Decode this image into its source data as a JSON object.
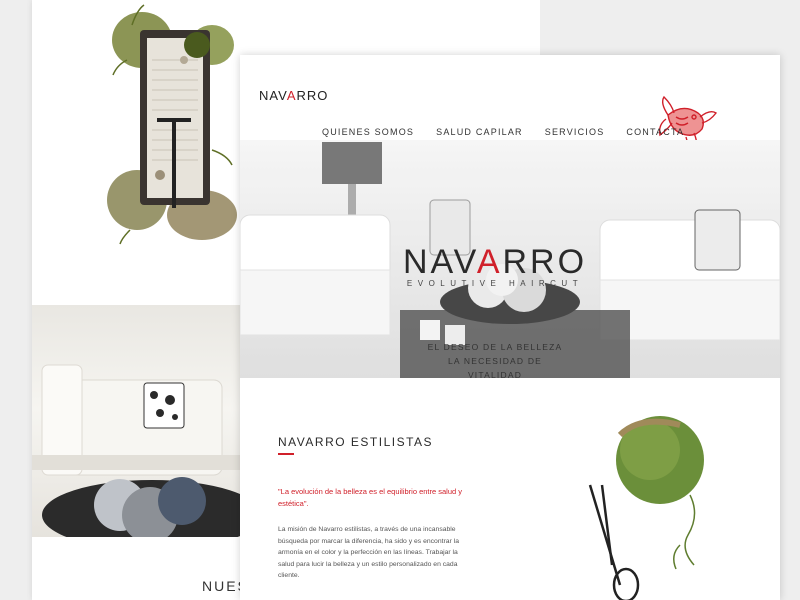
{
  "back_page": {
    "partial_heading": "NUES"
  },
  "front_page": {
    "logo": {
      "pre": "NAV",
      "accent": "A",
      "post": "RRO"
    },
    "nav": [
      {
        "label": "QUIENES SOMOS"
      },
      {
        "label": "SALUD CAPILAR"
      },
      {
        "label": "SERVICIOS"
      },
      {
        "label": "CONTACTA"
      }
    ],
    "hero": {
      "logo": {
        "pre": "NAV",
        "accent": "A",
        "post": "RRO"
      },
      "subtitle": "EVOLUTIVE HAIRCUT",
      "tagline_line1": "EL DESEO DE LA BELLEZA",
      "tagline_line2": "LA NECESIDAD DE VITALIDAD"
    },
    "about": {
      "title": "NAVARRO ESTILISTAS",
      "quote": "\"La evolución de la belleza es el equilibrio entre salud y estética\".",
      "mission": "La misión de Navarro estilistas, a través de una incansable búsqueda por marcar la diferencia, ha sido y es encontrar la armonía en el color y la perfección en las líneas. Trabajar la salud para lucir la belleza y un estilo personalizado en cada cliente."
    }
  },
  "colors": {
    "accent": "#d0202a",
    "text_dark": "#2b2b2b",
    "background": "#eeeeee"
  },
  "icons": {
    "fish": "goldfish-icon",
    "garden": "zen-garden-image",
    "scissors": "scissors-icon",
    "moss_ball": "moss-ball-image"
  }
}
